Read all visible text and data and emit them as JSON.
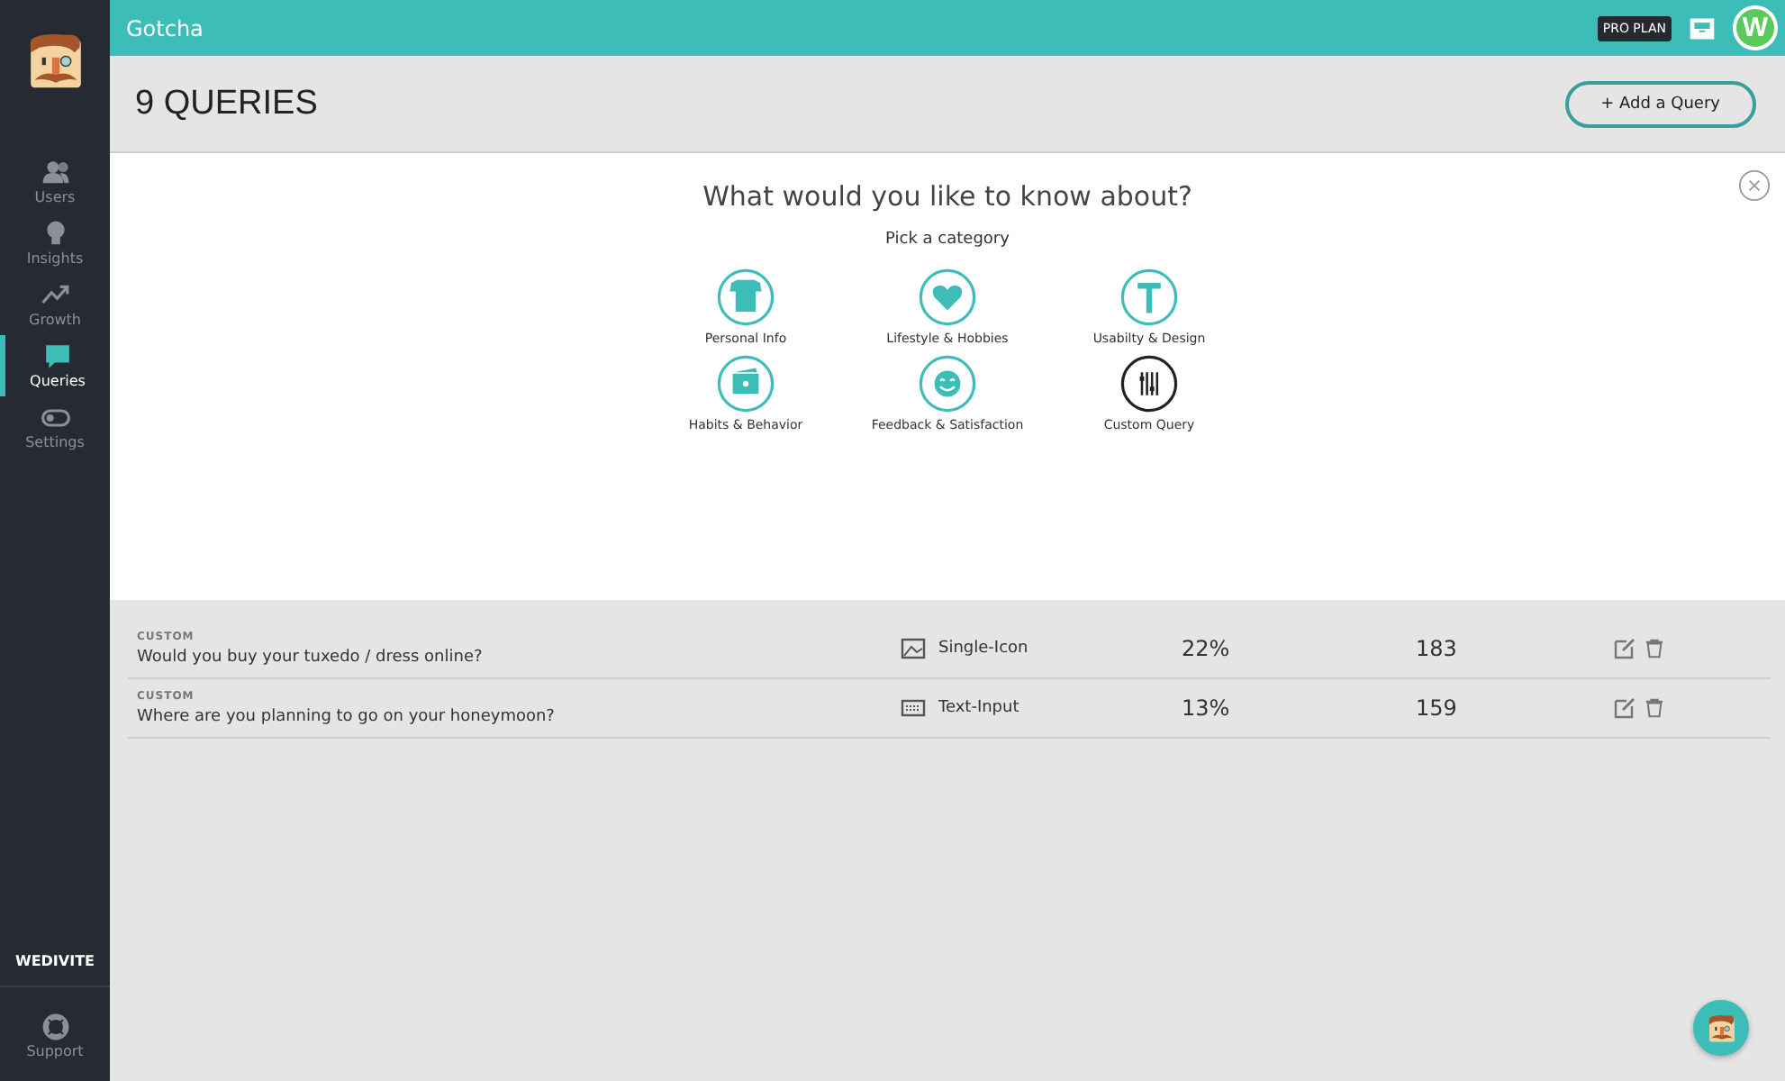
{
  "app": {
    "title": "Gotcha",
    "plan_badge": "PRO PLAN",
    "account_initial": "W"
  },
  "sidebar": {
    "items": [
      {
        "label": "Users",
        "kind": "users",
        "selected": false
      },
      {
        "label": "Insights",
        "kind": "bulb",
        "selected": false
      },
      {
        "label": "Growth",
        "kind": "growth",
        "selected": false
      },
      {
        "label": "Queries",
        "kind": "chat",
        "selected": true
      },
      {
        "label": "Settings",
        "kind": "toggle",
        "selected": false
      }
    ],
    "workspace": "WEDIVITE",
    "support": "Support"
  },
  "header": {
    "title": "9 QUERIES",
    "add_button": "+ Add a Query"
  },
  "queries": [
    {
      "category": "CUSTOM",
      "question": "Would you buy your tuxedo / dress online?",
      "type": "Single-Icon",
      "kind": "image",
      "rate": "22%",
      "responses": "183"
    },
    {
      "category": "CUSTOM",
      "question": "Where are you planning to go on your honeymoon?",
      "type": "Text-Input",
      "kind": "keyboard",
      "rate": "13%",
      "responses": "159"
    }
  ],
  "modal": {
    "title": "What would you like to know about?",
    "subtitle": "Pick a category",
    "categories": [
      {
        "label": "Personal Info",
        "kind": "shirt"
      },
      {
        "label": "Lifestyle & Hobbies",
        "kind": "heart"
      },
      {
        "label": "Usabilty & Design",
        "kind": "hammer"
      },
      {
        "label": "Habits & Behavior",
        "kind": "card"
      },
      {
        "label": "Feedback & Satisfaction",
        "kind": "smile"
      },
      {
        "label": "Custom Query",
        "kind": "custom"
      }
    ]
  }
}
